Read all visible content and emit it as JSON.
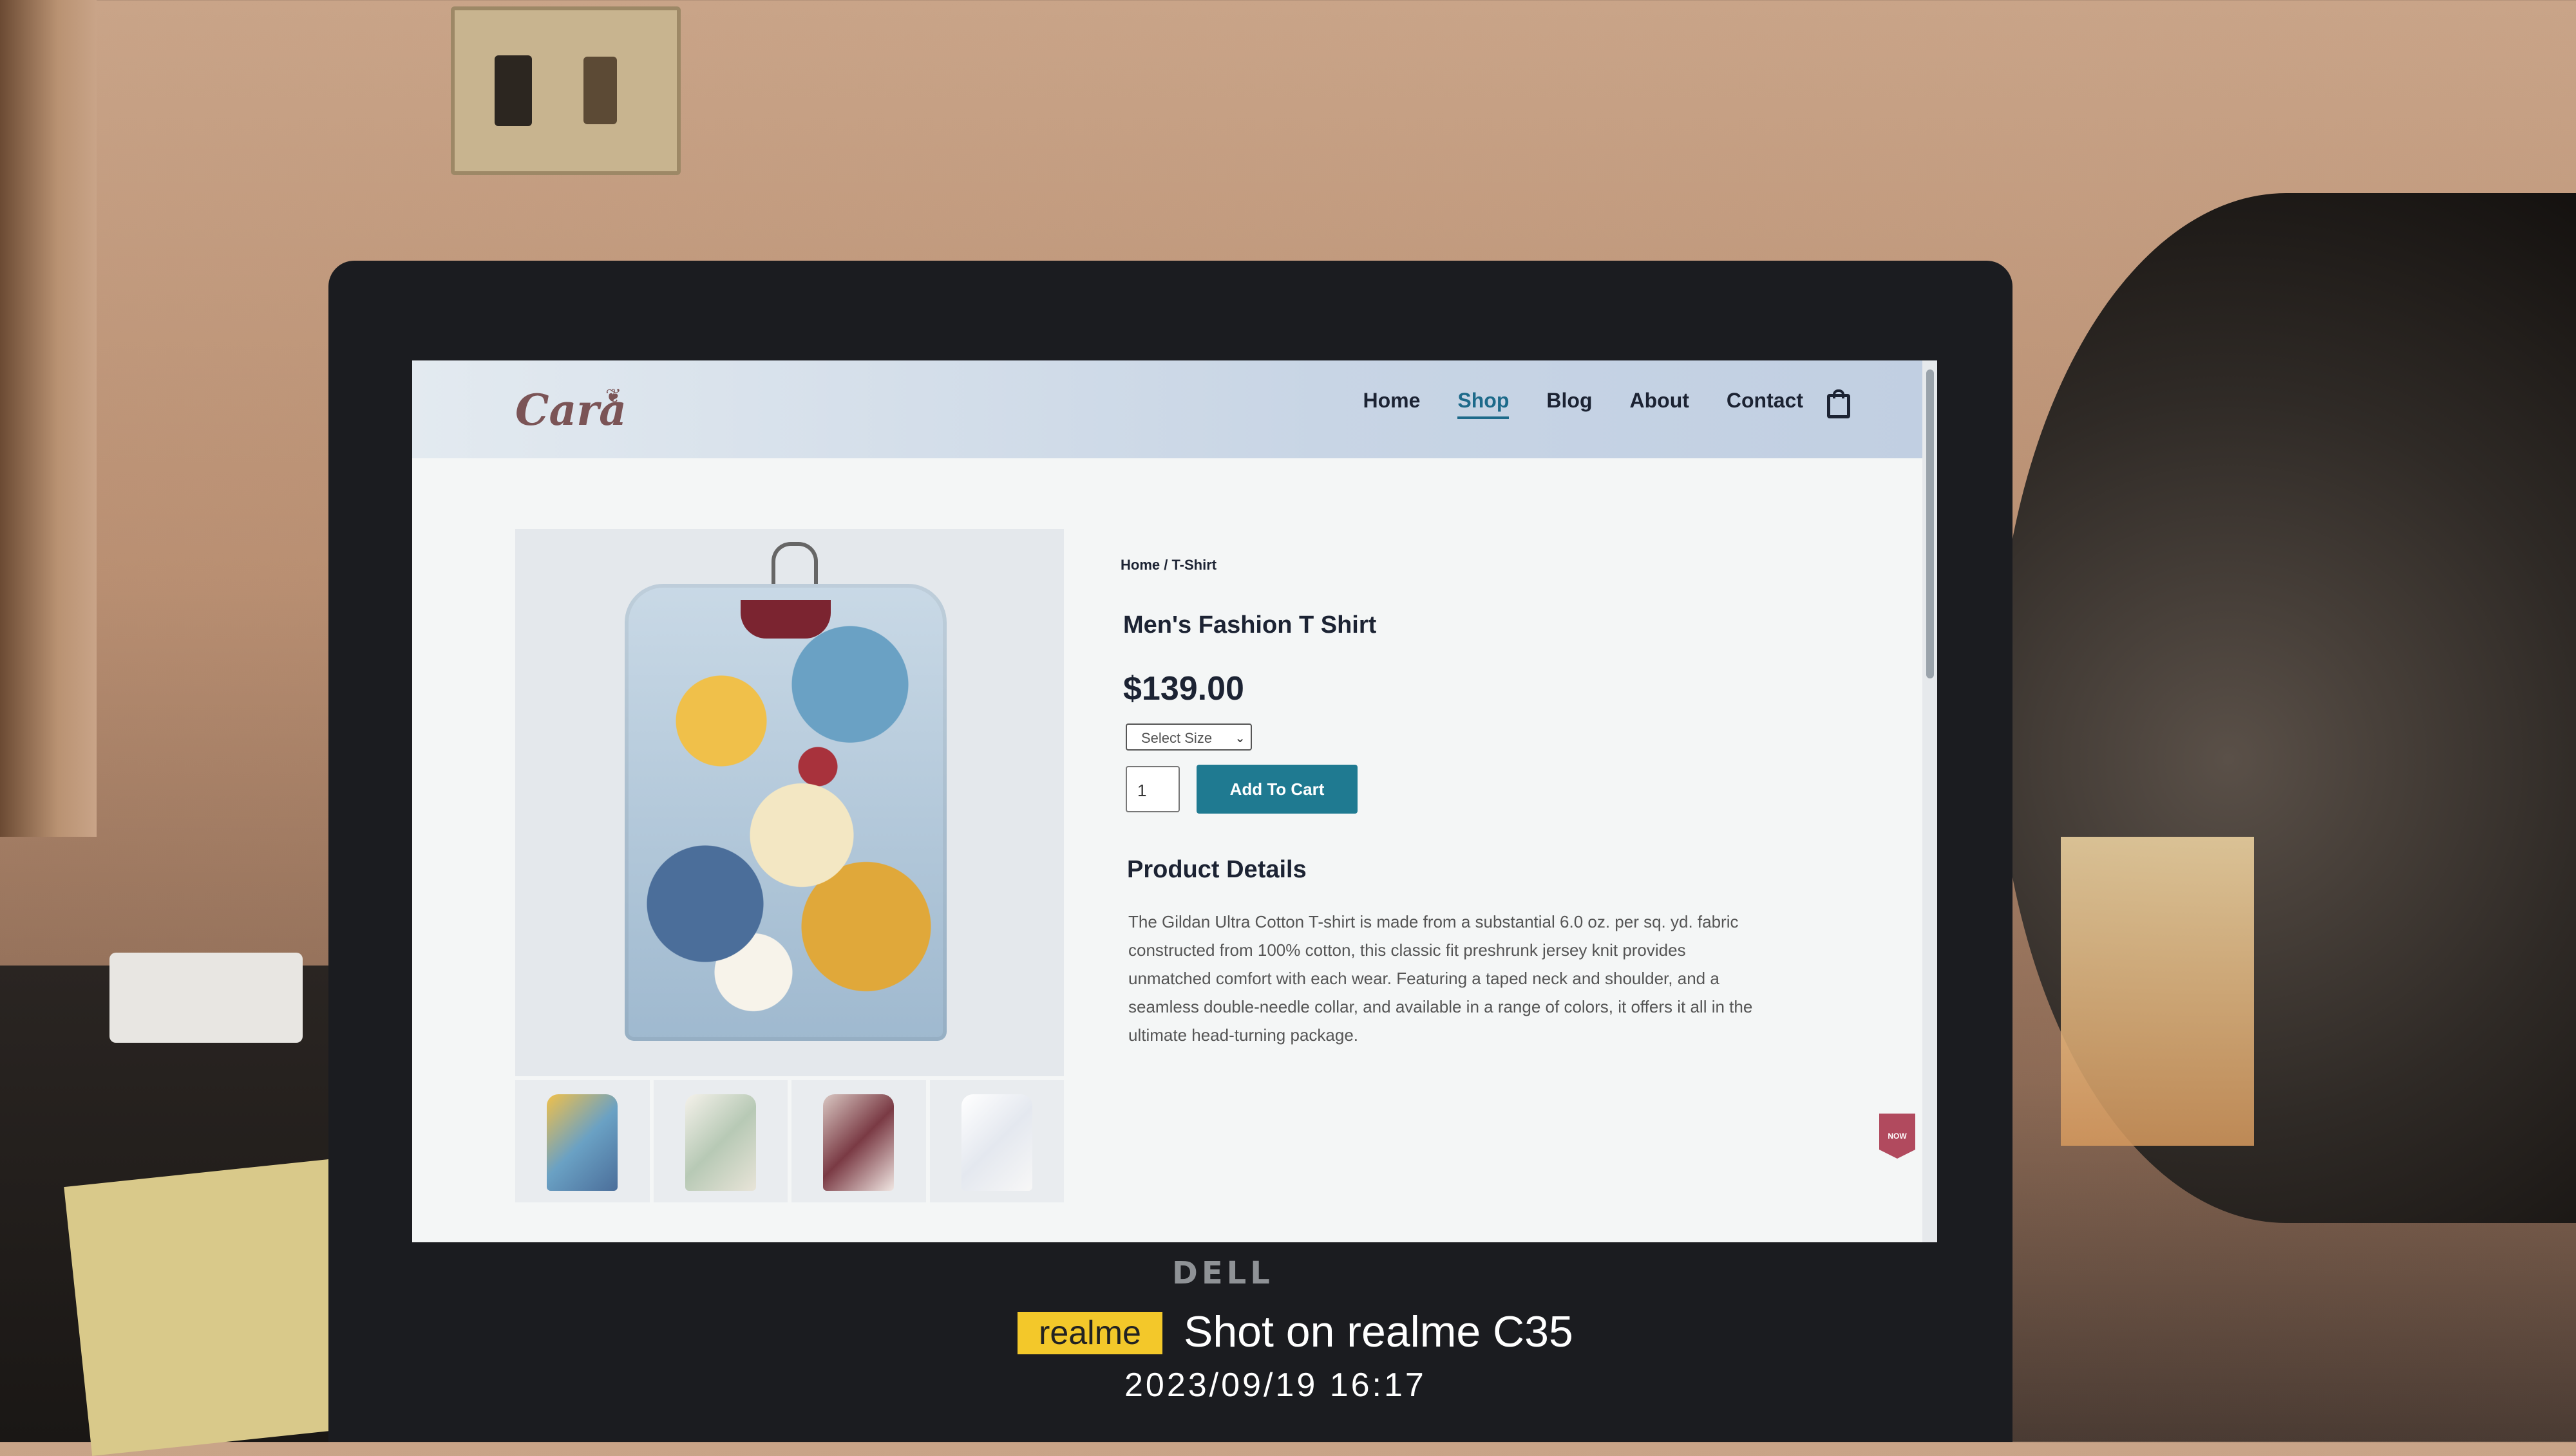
{
  "site": {
    "logo": "Cara",
    "nav": [
      "Home",
      "Shop",
      "Blog",
      "About",
      "Contact"
    ],
    "active_nav": "Shop"
  },
  "product": {
    "breadcrumb": "Home / T-Shirt",
    "title": "Men's Fashion T Shirt",
    "price": "$139.00",
    "size_select": "Select Size",
    "quantity": "1",
    "add_to_cart": "Add To Cart",
    "details_heading": "Product Details",
    "description": "The Gildan Ultra Cotton T-shirt is made from a substantial 6.0 oz. per sq. yd. fabric constructed from 100% cotton, this classic fit preshrunk jersey knit provides unmatched comfort with each wear. Featuring a taped neck and shoulder, and a seamless double-needle collar, and available in a range of colors, it offers it all in the ultimate head-turning package."
  },
  "badge": "NOW",
  "device": {
    "brand": "DELL"
  },
  "watermark": {
    "brand": "realme",
    "text": "Shot on realme C35",
    "datetime": "2023/09/19  16:17"
  },
  "colors": {
    "accent": "#1f7a91",
    "logo": "#7b5456"
  }
}
